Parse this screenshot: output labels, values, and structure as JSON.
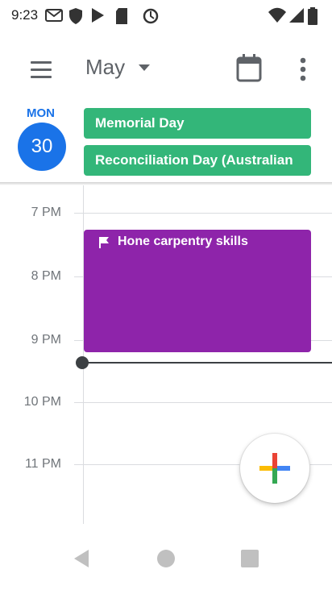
{
  "status_bar": {
    "time": "9:23",
    "left_icons": [
      "gmail-icon",
      "shield-icon",
      "play-store-icon",
      "sd-card-icon",
      "sync-icon"
    ],
    "right_icons": [
      "wifi-icon",
      "signal-icon",
      "battery-icon"
    ]
  },
  "app_bar": {
    "month": "May",
    "icons": [
      "menu-icon",
      "chevron-down-icon",
      "calendar-today-icon",
      "more-vert-icon"
    ]
  },
  "day_header": {
    "day_of_week": "MON",
    "day_number": "30",
    "all_day_events": [
      {
        "title": "Memorial Day",
        "color": "#33b679"
      },
      {
        "title": "Reconciliation Day (Australian",
        "color": "#33b679"
      }
    ]
  },
  "schedule": {
    "hours": [
      "7 PM",
      "8 PM",
      "9 PM",
      "10 PM",
      "11 PM"
    ],
    "event": {
      "title": "Hone carpentry skills",
      "color": "#8e24aa",
      "icon": "flag-icon"
    },
    "current_time_color": "#3c4043"
  },
  "colors": {
    "accent": "#1a73e8"
  },
  "fab": {
    "icon": "plus-icon"
  },
  "nav_bar": {
    "icons": [
      "back-icon",
      "home-icon",
      "recents-icon"
    ]
  }
}
